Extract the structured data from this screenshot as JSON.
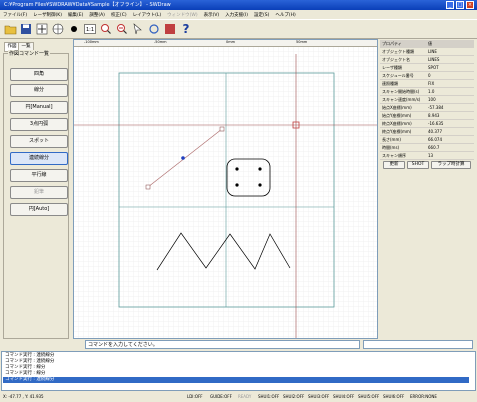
{
  "window": {
    "title": "C:¥Program Files¥SWDRAW¥Data¥Sample【オフライン】 - SWDraw",
    "min": "_",
    "max": "□",
    "close": "×"
  },
  "menu": [
    "ファイル(F)",
    "レーザ制御(K)",
    "編集(E)",
    "調整(A)",
    "校正(C)",
    "レイアウト(L)",
    "ウィンドウ(W)",
    "表示(V)",
    "入力支援(I)",
    "設定(S)",
    "ヘルプ(H)"
  ],
  "tabs": [
    "作図",
    "一覧"
  ],
  "commands": {
    "group_title": "作図コマンド一覧",
    "items": [
      "四角",
      "線分",
      "円[Manual]",
      "3点円弧",
      "スポット",
      "連続線分",
      "平行線",
      "鉛筆",
      "円[Auto]"
    ],
    "active": "連続線分",
    "disabled": "鉛筆"
  },
  "ruler": {
    "labels": [
      "-100mm",
      "-50mm",
      "0mm",
      "50mm"
    ]
  },
  "properties": {
    "header_key": "プロパティ",
    "header_val": "値",
    "rows": [
      {
        "k": "オブジェクト種類",
        "v": "LINE"
      },
      {
        "k": "オブジェクト名",
        "v": "LINES"
      },
      {
        "k": "レーザ種類",
        "v": "SPOT"
      },
      {
        "k": "スケジュール番号",
        "v": "0"
      },
      {
        "k": "連照種類",
        "v": "FIX"
      },
      {
        "k": "スキャン開始時間(s)",
        "v": "1.0"
      },
      {
        "k": "スキャン速度(mm/s)",
        "v": "100"
      },
      {
        "k": "始点X座標(mm)",
        "v": "-57.384"
      },
      {
        "k": "始点Y座標(mm)",
        "v": "8.943"
      },
      {
        "k": "終点X座標(mm)",
        "v": "-16.635"
      },
      {
        "k": "終点Y座標(mm)",
        "v": "40.377"
      },
      {
        "k": "長さ(mm)",
        "v": "66.074"
      },
      {
        "k": "時間(ms)",
        "v": "660.7"
      },
      {
        "k": "スキャン順序",
        "v": "13"
      }
    ],
    "buttons": [
      "更新",
      "SHOT",
      "ラップ時計算"
    ]
  },
  "command_prompt": "コマンドを入力してください。",
  "log": [
    "コマンド実行 : 連続線分",
    "コマンド実行 : 連続線分",
    "コマンド実行 : 線分",
    "コマンド実行 : 線分",
    "コマンド実行 : 連続線分"
  ],
  "status": {
    "coord": "X: -47.77 , Y: 41.935",
    "items": [
      "LDI:OFF",
      "GUIDE:OFF",
      "READY",
      "SHUI1:OFF",
      "SHUI2:OFF",
      "SHUI3:OFF",
      "SHUI4:OFF",
      "SHUI5:OFF",
      "SHUI6:OFF",
      "ERROR:NONE"
    ]
  },
  "colors": {
    "accent": "#316ac5",
    "shape": "#b05050",
    "grid": "#dddddd"
  }
}
